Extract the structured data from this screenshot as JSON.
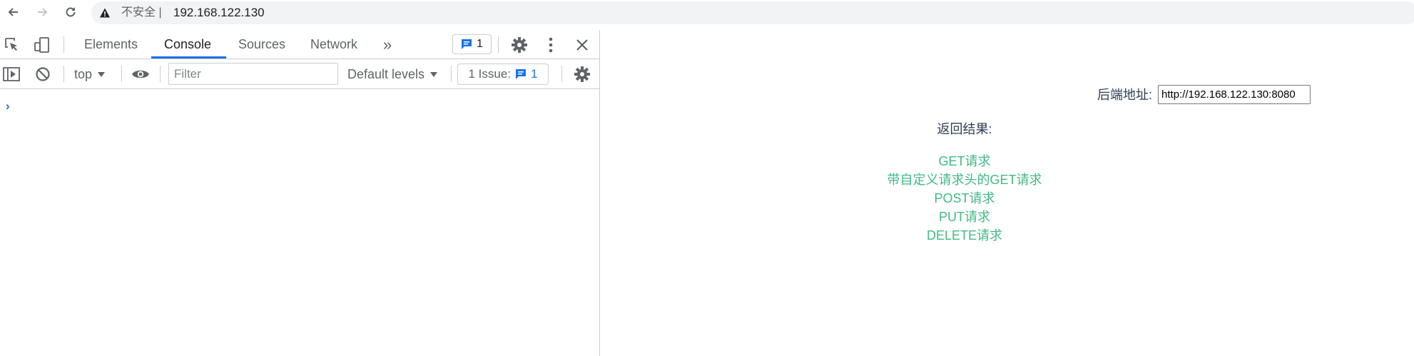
{
  "browser": {
    "security_label": "不安全",
    "separator": "|",
    "url": "192.168.122.130"
  },
  "devtools": {
    "tabs": [
      {
        "label": "Elements",
        "active": false
      },
      {
        "label": "Console",
        "active": true
      },
      {
        "label": "Sources",
        "active": false
      },
      {
        "label": "Network",
        "active": false
      }
    ],
    "more_tabs": "»",
    "messages_count": "1",
    "console": {
      "context": "top",
      "filter_placeholder": "Filter",
      "levels": "Default levels",
      "issues_label": "1 Issue:",
      "issues_count": "1",
      "prompt": "›"
    },
    "accent_color": "#1a73e8"
  },
  "page": {
    "backend_label": "后端地址:",
    "backend_value": "http://192.168.122.130:8080",
    "result_label": "返回结果:",
    "links": [
      "GET请求",
      "带自定义请求头的GET请求",
      "POST请求",
      "PUT请求",
      "DELETE请求"
    ],
    "link_color": "#42b983"
  }
}
